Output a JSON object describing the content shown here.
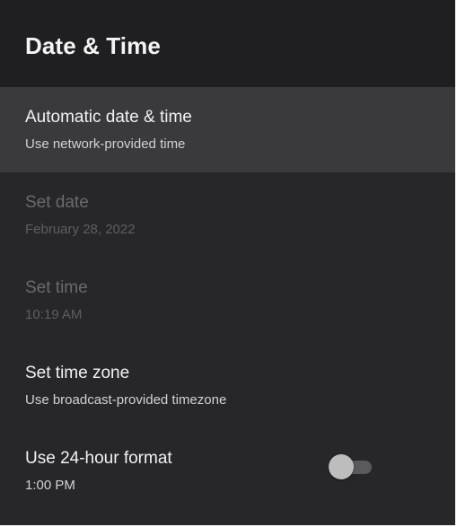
{
  "header": {
    "title": "Date & Time"
  },
  "items": [
    {
      "title": "Automatic date & time",
      "subtitle": "Use network-provided time",
      "state": "focused"
    },
    {
      "title": "Set date",
      "subtitle": "February 28, 2022",
      "state": "disabled"
    },
    {
      "title": "Set time",
      "subtitle": "10:19 AM",
      "state": "disabled"
    },
    {
      "title": "Set time zone",
      "subtitle": "Use broadcast-provided timezone",
      "state": "enabled"
    },
    {
      "title": "Use 24-hour format",
      "subtitle": "1:00 PM",
      "state": "enabled",
      "toggle_on": false
    }
  ],
  "colors": {
    "background": "#27272a",
    "header_background": "#1f1f21",
    "focused_background": "#3a3a3d",
    "text_primary": "#f2f2f2",
    "text_disabled": "#6a6a6d"
  }
}
